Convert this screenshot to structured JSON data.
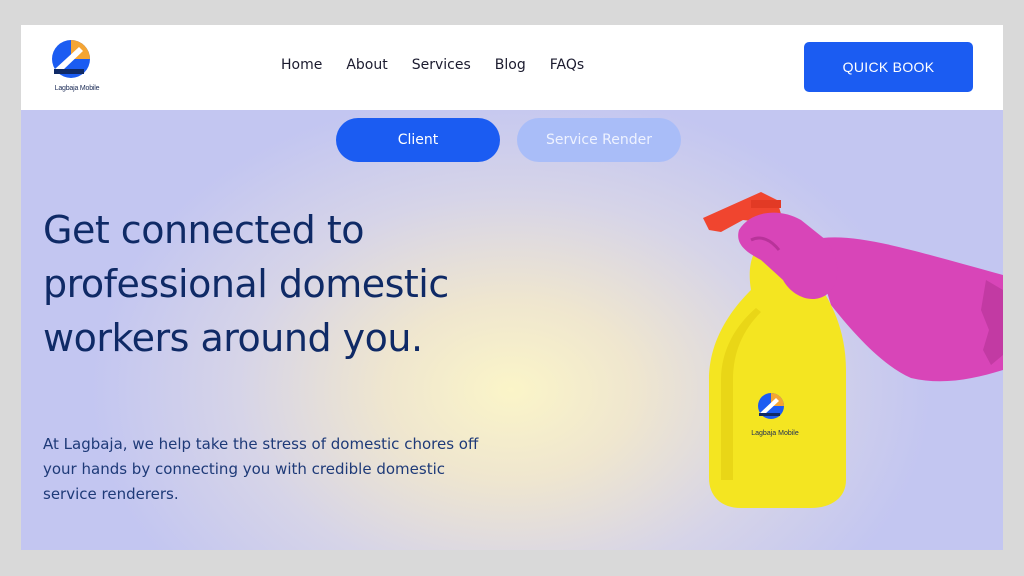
{
  "brand": {
    "name": "Lagbaja Mobile",
    "colors": {
      "blue": "#1b5cf2",
      "navy": "#0f2a66",
      "orange": "#f4a534",
      "light_blue": "#a9bdf8"
    }
  },
  "nav": {
    "links": [
      "Home",
      "About",
      "Services",
      "Blog",
      "FAQs"
    ],
    "cta": "QUICK BOOK"
  },
  "toggle": {
    "client": "Client",
    "service_render": "Service Render",
    "active": "Client"
  },
  "hero": {
    "headline": "Get connected to professional domestic workers around you.",
    "subtext": "At Lagbaja, we help take the stress of domestic chores off your hands by connecting you with credible domestic service renderers.",
    "image": "gloved-hand-holding-yellow-spray-bottle",
    "bottle_logo_text": "Lagbaja Mobile"
  }
}
